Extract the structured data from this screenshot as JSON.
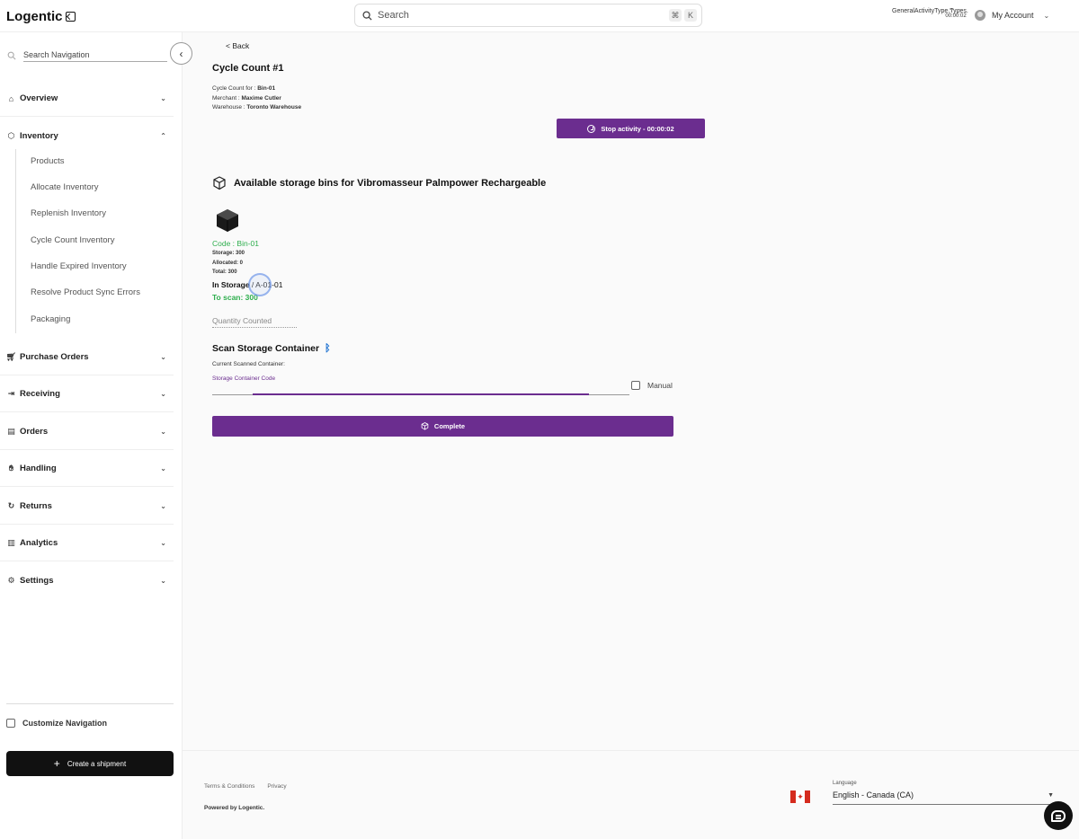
{
  "header": {
    "logo": "Logentic",
    "search_placeholder": "Search",
    "shortcut_keys": [
      "⌘",
      "K"
    ],
    "activity_type": "GeneralActivityType.Types.",
    "activity_timer": "00:00:02",
    "account_label": "My Account"
  },
  "sidebar": {
    "search_label": "Search Navigation",
    "sections": [
      {
        "label": "Overview",
        "icon": "home-icon",
        "expanded": false
      },
      {
        "label": "Inventory",
        "icon": "cube-icon",
        "expanded": true
      },
      {
        "label": "Purchase Orders",
        "icon": "cart-icon",
        "expanded": false
      },
      {
        "label": "Receiving",
        "icon": "receiving-icon",
        "expanded": false
      },
      {
        "label": "Orders",
        "icon": "document-icon",
        "expanded": false
      },
      {
        "label": "Handling",
        "icon": "hand-icon",
        "expanded": false
      },
      {
        "label": "Returns",
        "icon": "return-icon",
        "expanded": false
      },
      {
        "label": "Analytics",
        "icon": "bar-chart-icon",
        "expanded": false
      },
      {
        "label": "Settings",
        "icon": "gear-icon",
        "expanded": false
      }
    ],
    "inventory_items": [
      "Products",
      "Allocate Inventory",
      "Replenish Inventory",
      "Cycle Count Inventory",
      "Handle Expired Inventory",
      "Resolve Product Sync Errors",
      "Packaging"
    ],
    "customize_label": "Customize Navigation",
    "create_shipment_label": "Create a shipment"
  },
  "main": {
    "back_label": "< Back",
    "title": "Cycle Count #1",
    "cycle_count_for_label": "Cycle Count for : ",
    "cycle_count_for_value": "Bin-01",
    "merchant_label": "Merchant : ",
    "merchant_value": "Maxime Cutler",
    "warehouse_label": "Warehouse : ",
    "warehouse_value": "Toronto Warehouse",
    "stop_activity_label": "Stop activity - 00:00:02",
    "bins_heading": "Available storage bins for Vibromasseur Palmpower Rechargeable",
    "bin": {
      "code": "Code : Bin-01",
      "storage": "Storage: 300",
      "allocated": "Allocated: 0",
      "total": "Total: 300",
      "in_storage_label": "In Storage",
      "in_storage_value": " / A-01-01",
      "to_scan": "To scan: 300"
    },
    "quantity_placeholder": "Quantity Counted",
    "scan_heading": "Scan Storage Container",
    "current_scanned_label": "Current Scanned Container:",
    "container_code_label": "Storage Container Code",
    "manual_label": "Manual",
    "complete_label": "Complete",
    "accent_color": "#6b2d8f",
    "success_color": "#2eae4d"
  },
  "footer": {
    "terms": "Terms & Conditions",
    "privacy": "Privacy",
    "powered_by": "Powered by Logentic.",
    "language_label": "Language",
    "language_value": "English - Canada (CA)"
  }
}
